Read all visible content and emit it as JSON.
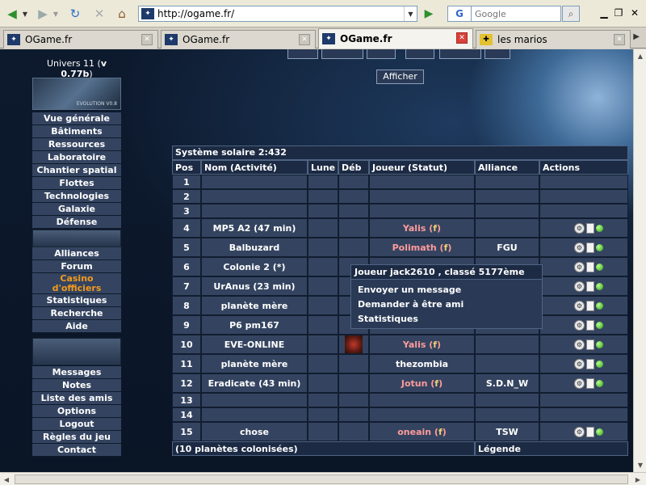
{
  "browser": {
    "url": "http://ogame.fr/",
    "search_placeholder": "Google",
    "search_engine_letter": "G"
  },
  "tabs": [
    {
      "label": "OGame.fr",
      "active": false
    },
    {
      "label": "OGame.fr",
      "active": false
    },
    {
      "label": "OGame.fr",
      "active": true
    },
    {
      "label": "les marios",
      "active": false
    }
  ],
  "sidebar": {
    "universe_label": "Univers 11 (",
    "version": "v 0.77b",
    "universe_suffix": ")",
    "logo_text": "EVOLUTION V0.8",
    "menu1": [
      "Vue générale",
      "Bâtiments",
      "Ressources",
      "Laboratoire",
      "Chantier spatial",
      "Flottes",
      "Technologies",
      "Galaxie",
      "Défense"
    ],
    "menu2": [
      "Alliances",
      "Forum"
    ],
    "casino_line1": "Casino",
    "casino_line2": "d'officiers",
    "menu3": [
      "Statistiques",
      "Recherche",
      "Aide"
    ],
    "menu4": [
      "Messages",
      "Notes",
      "Liste des amis",
      "Options",
      "Logout",
      "Règles du jeu",
      "Contact"
    ]
  },
  "show_button": "Afficher",
  "galaxy": {
    "caption": "Système solaire 2:432",
    "headers": {
      "pos": "Pos",
      "name": "Nom (Activité)",
      "moon": "Lune",
      "debris": "Déb",
      "player": "Joueur (Statut)",
      "alliance": "Alliance",
      "actions": "Actions"
    },
    "rows": [
      {
        "pos": "1",
        "name": "",
        "player": "",
        "status": "",
        "alliance": "",
        "actions": false,
        "debris": false
      },
      {
        "pos": "2",
        "name": "",
        "player": "",
        "status": "",
        "alliance": "",
        "actions": false,
        "debris": false
      },
      {
        "pos": "3",
        "name": "",
        "player": "",
        "status": "",
        "alliance": "",
        "actions": false,
        "debris": false
      },
      {
        "pos": "4",
        "name": "MP5 A2 (47 min)",
        "player": "Yalis",
        "status": "f",
        "alliance": "",
        "actions": true,
        "debris": false
      },
      {
        "pos": "5",
        "name": "Balbuzard",
        "player": "Polimath",
        "status": "f",
        "alliance": "FGU",
        "actions": true,
        "debris": false
      },
      {
        "pos": "6",
        "name": "Colonie 2 (*)",
        "player": "",
        "status": "",
        "alliance": "",
        "actions": true,
        "debris": false
      },
      {
        "pos": "7",
        "name": "UrAnus (23 min)",
        "player": "",
        "status": "",
        "alliance": "",
        "actions": true,
        "debris": false
      },
      {
        "pos": "8",
        "name": "planète mère",
        "player": "",
        "status": "",
        "alliance": "",
        "actions": true,
        "debris": false
      },
      {
        "pos": "9",
        "name": "P6 pm167",
        "player": "",
        "status": "",
        "alliance": "",
        "actions": true,
        "debris": false
      },
      {
        "pos": "10",
        "name": "EVE-ONLINE",
        "player": "Yalis",
        "status": "f",
        "alliance": "",
        "actions": true,
        "debris": true
      },
      {
        "pos": "11",
        "name": "planète mère",
        "player": "thezombia",
        "status": "",
        "alliance": "",
        "actions": true,
        "debris": false,
        "plain": true
      },
      {
        "pos": "12",
        "name": "Eradicate (43 min)",
        "player": "Jotun",
        "status": "f",
        "alliance": "S.D.N_W",
        "actions": true,
        "debris": false
      },
      {
        "pos": "13",
        "name": "",
        "player": "",
        "status": "",
        "alliance": "",
        "actions": false,
        "debris": false
      },
      {
        "pos": "14",
        "name": "",
        "player": "",
        "status": "",
        "alliance": "",
        "actions": false,
        "debris": false
      },
      {
        "pos": "15",
        "name": "chose",
        "player": "oneain",
        "status": "f",
        "alliance": "TSW",
        "actions": true,
        "debris": false
      }
    ],
    "footer_left": "(10 planètes colonisées)",
    "footer_right": "Légende"
  },
  "tooltip": {
    "title": "Joueur jack2610 , classé 5177ème",
    "items": [
      "Envoyer un message",
      "Demander à être ami",
      "Statistiques"
    ]
  }
}
